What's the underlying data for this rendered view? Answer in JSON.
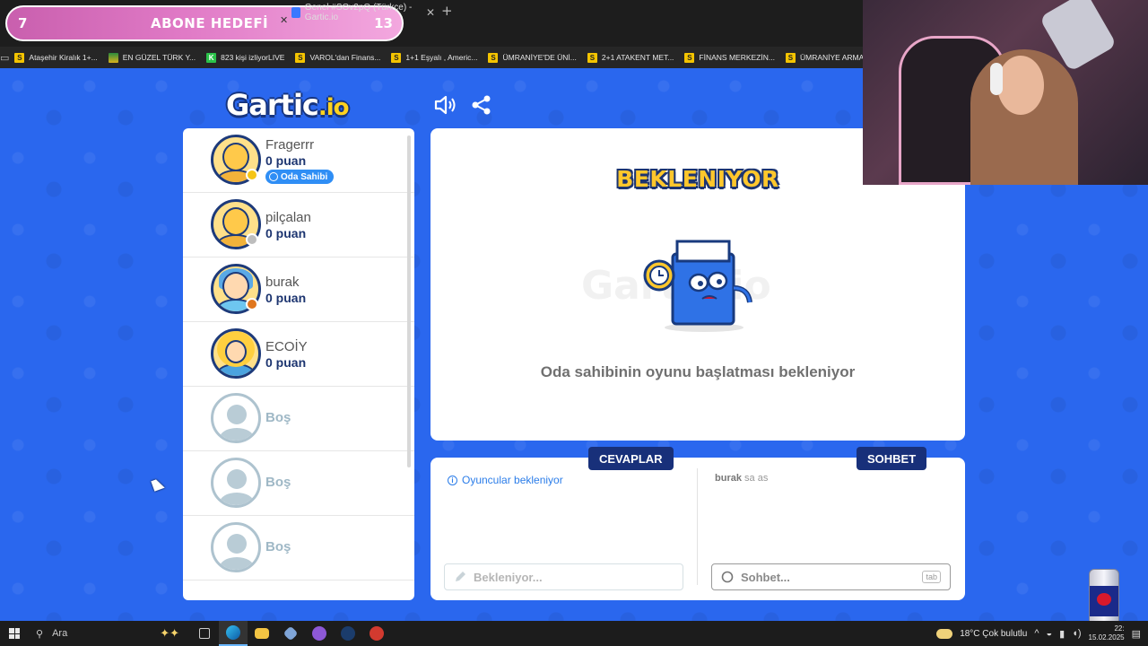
{
  "browser": {
    "abone": {
      "left_num": "7",
      "title": "ABONE HEDEFİ",
      "right_num": "13"
    },
    "tab": {
      "title": "Genel #SOv2pQ (Türkçe) - Gartic.io"
    },
    "bookmarks": [
      {
        "label": "Ataşehir Kiralık 1+...",
        "icon": "S",
        "kind": "yellow"
      },
      {
        "label": "EN GÜZEL TÜRK Y...",
        "icon": "",
        "kind": "flag"
      },
      {
        "label": "823 kişi izliyorLIVE",
        "icon": "K",
        "kind": "green"
      },
      {
        "label": "VAROL'dan Finans...",
        "icon": "S",
        "kind": "yellow"
      },
      {
        "label": "1+1 Eşyalı , Americ...",
        "icon": "S",
        "kind": "yellow"
      },
      {
        "label": "ÜMRANİYE'DE ÜNİ...",
        "icon": "S",
        "kind": "yellow"
      },
      {
        "label": "2+1 ATAKENT MET...",
        "icon": "S",
        "kind": "yellow"
      },
      {
        "label": "FİNANS MERKEZİN...",
        "icon": "S",
        "kind": "yellow"
      },
      {
        "label": "ÜMRANİYE ARMA...",
        "icon": "S",
        "kind": "yellow"
      }
    ]
  },
  "app": {
    "logo_main": "Gartic",
    "logo_suffix": ".io",
    "players": [
      {
        "name": "Fragerrr",
        "score": "0 puan",
        "badge": "Oda Sahibi",
        "avatar": "yellow",
        "dot_color": "#f5c518"
      },
      {
        "name": "pilçalan",
        "score": "0 puan",
        "avatar": "yellow",
        "dot_color": "#bdbdbd"
      },
      {
        "name": "burak",
        "score": "0 puan",
        "avatar": "blue",
        "dot_color": "#e0761d"
      },
      {
        "name": "ECOİY",
        "score": "0 puan",
        "avatar": "curly",
        "dot_color": ""
      },
      {
        "name": "Boş",
        "empty": true
      },
      {
        "name": "Boş",
        "empty": true
      },
      {
        "name": "Boş",
        "empty": true
      }
    ],
    "main": {
      "title": "BEKLENIYOR",
      "watermark": "Gartic.io",
      "message": "Oda sahibinin oyunu başlatması bekleniyor"
    },
    "answers": {
      "tab_label": "CEVAPLAR",
      "info": "Oyuncular bekleniyor",
      "placeholder": "Bekleniyor..."
    },
    "chat": {
      "tab_label": "SOHBET",
      "messages": [
        {
          "user": "burak",
          "text": "sa as"
        }
      ],
      "placeholder": "Sohbet...",
      "tab_hint": "tab"
    }
  },
  "taskbar": {
    "search_label": "Ara",
    "weather": "18°C  Çok bulutlu",
    "clock_time": "22:",
    "clock_date": "15.02.2025"
  }
}
